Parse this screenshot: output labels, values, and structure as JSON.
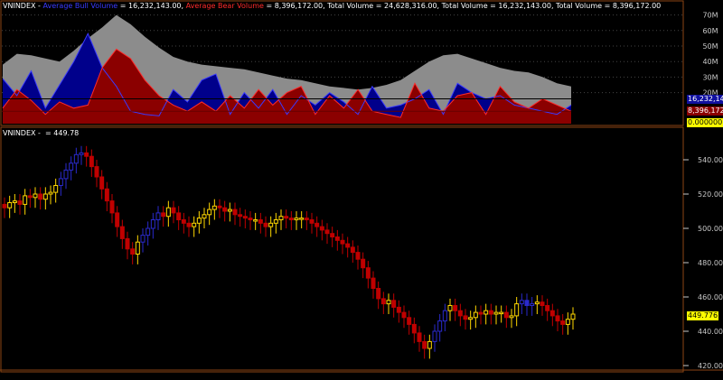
{
  "top_panel": {
    "symbol": "VNINDEX",
    "dash": "-",
    "buy_label": "Average Bull Volume",
    "buy_value": "16,232,143.00",
    "bear_label": "Average Bear Volume",
    "bear_value": "8,396,172.00",
    "total1_label": "Total Volume",
    "total1_value": "24,628,316.00",
    "total2_label": "Total Volume",
    "total2_value": "16,232,143.00",
    "total3_label": "Total Volume",
    "total3_value": "8,396,172.00",
    "tags": {
      "bull": "16,232,14",
      "bear": "8,396,172",
      "zero": "0.000000"
    }
  },
  "bottom_panel": {
    "symbol": "VNINDEX",
    "dash": "-",
    "eq": "=",
    "close_value": "449.78",
    "last_tag": "449.776"
  },
  "colors": {
    "bull_area": "#00008b",
    "bear_area": "#8b0000",
    "total_area": "#8c8c8c",
    "bull_line": "#3a3aff",
    "bear_line": "#ff2a2a",
    "up_candle": "#ffd700",
    "down_candle": "#c00000",
    "trend_up": "#2a2acc",
    "frame": "#8b4513",
    "axis_text": "#c8c8c8"
  },
  "chart_data": [
    {
      "type": "area",
      "title": "",
      "y_ticks": [
        {
          "value": 20,
          "label": "20M"
        },
        {
          "value": 30,
          "label": "30M"
        },
        {
          "value": 40,
          "label": "40M"
        },
        {
          "value": 50,
          "label": "50M"
        },
        {
          "value": 60,
          "label": "60M"
        },
        {
          "value": 70,
          "label": "70M"
        }
      ],
      "ylim": [
        0,
        75
      ],
      "unit": "millions of shares",
      "series": [
        {
          "name": "Total Volume",
          "values": [
            38,
            45,
            44,
            42,
            40,
            47,
            55,
            62,
            70,
            64,
            56,
            49,
            43,
            40,
            38,
            37,
            36,
            35,
            33,
            31,
            29,
            28,
            26,
            24,
            23,
            22,
            23,
            25,
            28,
            34,
            40,
            44,
            45,
            42,
            39,
            36,
            34,
            33,
            30,
            26,
            24
          ]
        },
        {
          "name": "Average Bull Volume",
          "values": [
            29,
            18,
            34,
            10,
            25,
            40,
            58,
            36,
            24,
            8,
            6,
            5,
            22,
            14,
            28,
            32,
            6,
            20,
            10,
            22,
            6,
            18,
            12,
            20,
            14,
            6,
            24,
            10,
            12,
            16,
            22,
            6,
            26,
            20,
            16,
            18,
            12,
            10,
            8,
            6,
            12
          ]
        },
        {
          "name": "Average Bear Volume",
          "values": [
            10,
            22,
            15,
            6,
            14,
            10,
            12,
            36,
            48,
            42,
            28,
            18,
            12,
            8,
            14,
            8,
            18,
            10,
            22,
            12,
            20,
            24,
            6,
            18,
            10,
            22,
            8,
            6,
            4,
            26,
            10,
            8,
            18,
            20,
            6,
            24,
            14,
            10,
            16,
            12,
            8
          ]
        }
      ]
    },
    {
      "type": "candlestick",
      "title": "",
      "ylim": [
        420,
        550
      ],
      "y_ticks": [
        420,
        440,
        460,
        480,
        500,
        520,
        540
      ],
      "candles": [
        [
          514,
          512
        ],
        [
          512,
          515
        ],
        [
          515,
          516
        ],
        [
          516,
          514
        ],
        [
          514,
          519
        ],
        [
          519,
          518
        ],
        [
          518,
          520
        ],
        [
          520,
          517
        ],
        [
          517,
          520
        ],
        [
          520,
          521
        ],
        [
          521,
          525
        ],
        [
          525,
          529
        ],
        [
          529,
          534
        ],
        [
          534,
          538
        ],
        [
          538,
          543
        ],
        [
          543,
          544
        ],
        [
          544,
          542
        ],
        [
          542,
          536
        ],
        [
          536,
          530
        ],
        [
          530,
          523
        ],
        [
          523,
          516
        ],
        [
          516,
          509
        ],
        [
          509,
          501
        ],
        [
          501,
          494
        ],
        [
          494,
          488
        ],
        [
          488,
          485
        ],
        [
          485,
          492
        ],
        [
          492,
          496
        ],
        [
          496,
          500
        ],
        [
          500,
          505
        ],
        [
          505,
          509
        ],
        [
          509,
          507
        ],
        [
          507,
          512
        ],
        [
          512,
          509
        ],
        [
          509,
          505
        ],
        [
          505,
          503
        ],
        [
          503,
          501
        ],
        [
          501,
          503
        ],
        [
          503,
          506
        ],
        [
          506,
          508
        ],
        [
          508,
          511
        ],
        [
          511,
          513
        ],
        [
          513,
          512
        ],
        [
          512,
          510
        ],
        [
          510,
          511
        ],
        [
          511,
          508
        ],
        [
          508,
          507
        ],
        [
          507,
          506
        ],
        [
          506,
          505
        ],
        [
          505,
          505
        ],
        [
          505,
          503
        ],
        [
          503,
          501
        ],
        [
          501,
          503
        ],
        [
          503,
          505
        ],
        [
          505,
          507
        ],
        [
          507,
          506
        ],
        [
          506,
          505
        ],
        [
          505,
          506
        ],
        [
          506,
          506
        ],
        [
          506,
          505
        ],
        [
          505,
          503
        ],
        [
          503,
          501
        ],
        [
          501,
          499
        ],
        [
          499,
          497
        ],
        [
          497,
          495
        ],
        [
          495,
          493
        ],
        [
          493,
          491
        ],
        [
          491,
          489
        ],
        [
          489,
          486
        ],
        [
          486,
          482
        ],
        [
          482,
          477
        ],
        [
          477,
          471
        ],
        [
          471,
          465
        ],
        [
          465,
          459
        ],
        [
          459,
          456
        ],
        [
          456,
          458
        ],
        [
          458,
          454
        ],
        [
          454,
          451
        ],
        [
          451,
          448
        ],
        [
          448,
          444
        ],
        [
          444,
          439
        ],
        [
          439,
          434
        ],
        [
          434,
          430
        ],
        [
          430,
          434
        ],
        [
          434,
          440
        ],
        [
          440,
          446
        ],
        [
          446,
          452
        ],
        [
          452,
          455
        ],
        [
          455,
          452
        ],
        [
          452,
          449
        ],
        [
          449,
          447
        ],
        [
          447,
          448
        ],
        [
          448,
          451
        ],
        [
          451,
          450
        ],
        [
          450,
          452
        ],
        [
          452,
          450
        ],
        [
          450,
          451
        ],
        [
          451,
          451
        ],
        [
          451,
          448
        ],
        [
          448,
          449
        ],
        [
          449,
          456
        ],
        [
          456,
          458
        ],
        [
          458,
          455
        ],
        [
          455,
          456
        ],
        [
          456,
          457
        ],
        [
          457,
          455
        ],
        [
          455,
          452
        ],
        [
          452,
          449
        ],
        [
          449,
          446
        ],
        [
          446,
          444
        ],
        [
          444,
          447
        ],
        [
          447,
          450
        ]
      ]
    }
  ]
}
